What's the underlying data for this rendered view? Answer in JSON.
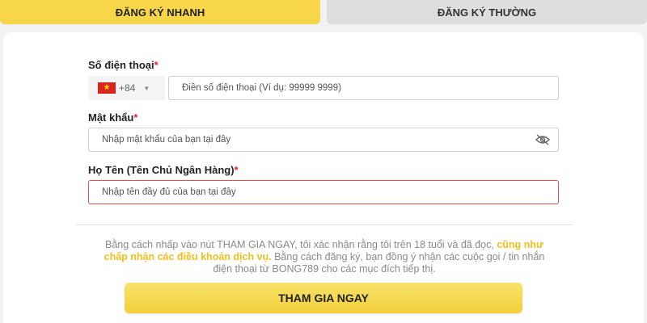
{
  "tabs": {
    "quick": "ĐĂNG KÝ NHANH",
    "normal": "ĐĂNG KÝ THƯỜNG"
  },
  "form": {
    "phone": {
      "label": "Số điện thoại",
      "required_mark": "*",
      "country_code": "+84",
      "placeholder": "Điền số điện thoại (Ví dụ: 99999 9999)"
    },
    "password": {
      "label": "Mật khẩu",
      "required_mark": "*",
      "placeholder": "Nhập mật khẩu của bạn tại đây",
      "toggle_icon": "eye-off-icon"
    },
    "fullname": {
      "label": "Họ Tên (Tên Chủ Ngân Hàng)",
      "required_mark": "*",
      "placeholder": "Nhập tên đầy đủ của bạn tại đây"
    }
  },
  "terms": {
    "part1": "Bằng cách nhấp vào nút THAM GIA NGAY, tôi xác nhận rằng tôi trên 18 tuổi và đã đọc, ",
    "highlight": "cũng như chấp nhận các điều khoản dịch vụ.",
    "part2": " Bằng cách đăng ký, bạn đồng ý nhận các cuộc gọi / tin nhắn điện thoại từ BONG789 cho các mục đích tiếp thị."
  },
  "submit_label": "THAM GIA NGAY",
  "colors": {
    "accent": "#f7d64a",
    "required": "#e0292b",
    "terms_highlight": "#f0c020",
    "error_border": "#d9534f"
  }
}
